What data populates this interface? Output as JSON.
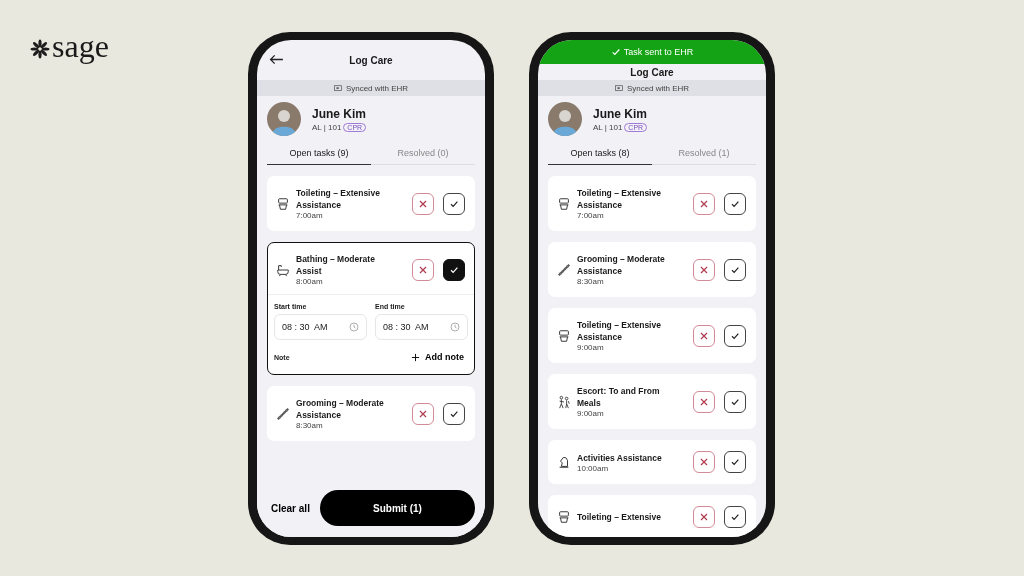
{
  "logo": {
    "text": "sage"
  },
  "phones": [
    {
      "title": "Log Care",
      "sync": "Synced with EHR",
      "resident": {
        "name": "June Kim",
        "unit": "AL | 101",
        "tag": "CPR"
      },
      "tabs": [
        {
          "label": "Open tasks (9)",
          "selected": true
        },
        {
          "label": "Resolved (0)",
          "selected": false
        }
      ],
      "tasks": [
        {
          "kind": "toilet",
          "title": "Toileting – Extensive Assistance",
          "time": "7:00am",
          "done": false,
          "expanded": false
        },
        {
          "kind": "bath",
          "title": "Bathing – Moderate Assist",
          "time": "8:00am",
          "done": true,
          "expanded": true,
          "details": {
            "fields": [
              {
                "label": "Start time",
                "value": "08 : 30  AM"
              },
              {
                "label": "End time",
                "value": "08 : 30  AM"
              }
            ],
            "note_label": "Note",
            "add_note": "Add note"
          }
        },
        {
          "kind": "comb",
          "title": "Grooming – Moderate Assistance",
          "time": "8:30am",
          "done": false,
          "expanded": false
        }
      ],
      "footer": {
        "clear": "Clear all",
        "submit": "Submit (1)"
      }
    },
    {
      "banner": "Task sent to EHR",
      "title": "Log Care",
      "sync": "Synced with EHR",
      "resident": {
        "name": "June Kim",
        "unit": "AL | 101",
        "tag": "CPR"
      },
      "tabs": [
        {
          "label": "Open tasks (8)",
          "selected": true
        },
        {
          "label": "Resolved (1)",
          "selected": false
        }
      ],
      "tasks": [
        {
          "kind": "toilet",
          "title": "Toileting – Extensive Assistance",
          "time": "7:00am",
          "done": false,
          "expanded": false
        },
        {
          "kind": "comb",
          "title": "Grooming – Moderate Assistance",
          "time": "8:30am",
          "done": false,
          "expanded": false
        },
        {
          "kind": "toilet",
          "title": "Toileting – Extensive Assistance",
          "time": "9:00am",
          "done": false,
          "expanded": false
        },
        {
          "kind": "escort",
          "title": "Escort: To and From Meals",
          "time": "9:00am",
          "done": false,
          "expanded": false
        },
        {
          "kind": "activity",
          "title": "Activities Assistance",
          "time": "10:00am",
          "done": false,
          "expanded": false
        },
        {
          "kind": "toilet",
          "title": "Toileting – Extensive",
          "done": false,
          "expanded": false
        }
      ]
    }
  ]
}
